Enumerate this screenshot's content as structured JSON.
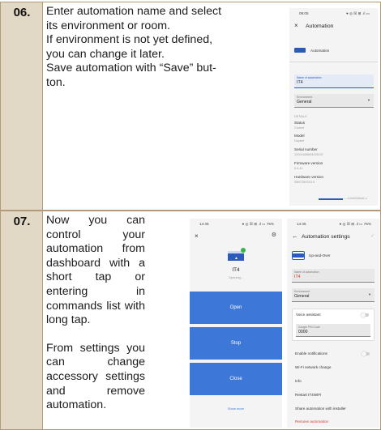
{
  "step6": {
    "number": "06.",
    "text": [
      "Enter automation name and select",
      "its environment or room.",
      "If environment is not yet defined,",
      "you can change it later.",
      "Save automation with “Save” but-",
      "ton."
    ]
  },
  "step7": {
    "number": "07.",
    "text_p1": "Now you can control your automation from dashboard with a short tap or entering in commands list with long tap.",
    "text_p2": "From settings you can change accessory settings and remove automation."
  },
  "screen_a": {
    "time": "09:05",
    "status_icons": "● ◎ ☒ ⊞ .ıl ▭",
    "title": "Automation",
    "device_label": "Automation",
    "name_label": "Name of automation",
    "name_value": "IT4",
    "env_label": "Environment",
    "env_value": "General",
    "details_label": "DETAILS",
    "status_label": "Status",
    "status_value": "Closed",
    "model_label": "Model",
    "model_value": "Daybet",
    "serial_label": "Serial number",
    "serial_value": "1200116B60422DCE",
    "firmware_label": "Firmware version",
    "firmware_value": "0.4.41",
    "hardware_label": "Hardware version",
    "hardware_value": "SBS758 R10.0",
    "continue_label": "CONTINUE >",
    "progress_fraction": 0.5
  },
  "screen_b": {
    "time": "14:45",
    "status_icons": "● ◎ ☒ ⊞ .ıl ▭ 75%",
    "close_icon": "×",
    "gear_icon": "gear-icon",
    "device_name": "IT4",
    "device_status": "Opening...",
    "btn_open": "Open",
    "btn_stop": "Stop",
    "btn_close": "Close",
    "show_more": "Show more"
  },
  "screen_c": {
    "time": "14:45",
    "status_icons": "● ◎ ☒ ⊞ .ıl ▭ 75%",
    "title": "Automation settings",
    "device_label": "Up-and-Over",
    "name_label": "Name of automation",
    "name_value": "IT4",
    "env_label": "Environment",
    "env_value": "General",
    "voice_label": "Voice assistant",
    "pin_label": "Google PIN Code",
    "pin_value": "0000",
    "notif_label": "Enable notifications",
    "wifi_label": "Wi-Fi network change",
    "info_label": "Info",
    "restart_label": "Restart IT4WIFI",
    "share_label": "Share automation with installer",
    "remove_label": "Remove automation"
  },
  "colors": {
    "accent": "#2a5bb8",
    "button": "#3d78d8",
    "danger": "#d63a2a",
    "number_cell": "#e2d8c6",
    "border": "#b39a78"
  }
}
